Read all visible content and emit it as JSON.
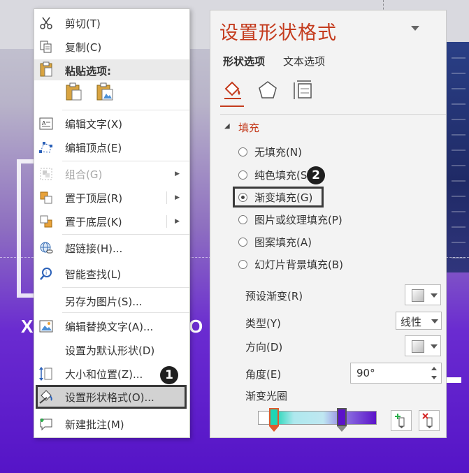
{
  "context_menu": {
    "items": [
      {
        "label": "剪切(T)",
        "icon": "scissors-icon"
      },
      {
        "label": "复制(C)",
        "icon": "copy-icon"
      },
      {
        "label": "粘贴选项:",
        "icon": "clipboard-icon"
      },
      {
        "label": "编辑文字(X)",
        "icon": "edit-text-icon"
      },
      {
        "label": "编辑顶点(E)",
        "icon": "edit-points-icon"
      },
      {
        "label": "组合(G)",
        "icon": "group-icon",
        "disabled": true
      },
      {
        "label": "置于顶层(R)",
        "icon": "bring-to-front-icon"
      },
      {
        "label": "置于底层(K)",
        "icon": "send-to-back-icon"
      },
      {
        "label": "超链接(H)...",
        "icon": "hyperlink-icon"
      },
      {
        "label": "智能查找(L)",
        "icon": "smart-lookup-icon"
      },
      {
        "label": "另存为图片(S)...",
        "icon": ""
      },
      {
        "label": "编辑替换文字(A)...",
        "icon": "alt-text-icon"
      },
      {
        "label": "设置为默认形状(D)",
        "icon": ""
      },
      {
        "label": "大小和位置(Z)...",
        "icon": "size-position-icon"
      },
      {
        "label": "设置形状格式(O)...",
        "icon": "format-shape-icon"
      },
      {
        "label": "新建批注(M)",
        "icon": "new-comment-icon"
      }
    ],
    "badge": "1"
  },
  "format_panel": {
    "title": "设置形状格式",
    "tabs": [
      "形状选项",
      "文本选项"
    ],
    "section": "填充",
    "fill_options": [
      "无填充(N)",
      "纯色填充(S)",
      "渐变填充(G)",
      "图片或纹理填充(P)",
      "图案填充(A)",
      "幻灯片背景填充(B)"
    ],
    "selected_fill": "渐变填充(G)",
    "badge": "2",
    "props": {
      "preset_label": "预设渐变(R)",
      "type_label": "类型(Y)",
      "type_value": "线性",
      "direction_label": "方向(D)",
      "angle_label": "角度(E)",
      "angle_value": "90°",
      "stops_label": "渐变光圈"
    },
    "gradient_stops": [
      {
        "color": "#1fd6b5"
      },
      {
        "color": "#5b12c9"
      }
    ]
  },
  "slide": {
    "letter_left": "X",
    "letter_right": "O"
  },
  "colors": {
    "accent": "#c43b1d",
    "panel_bg": "#f3f3f3",
    "slide_purple": "#5514c7"
  }
}
